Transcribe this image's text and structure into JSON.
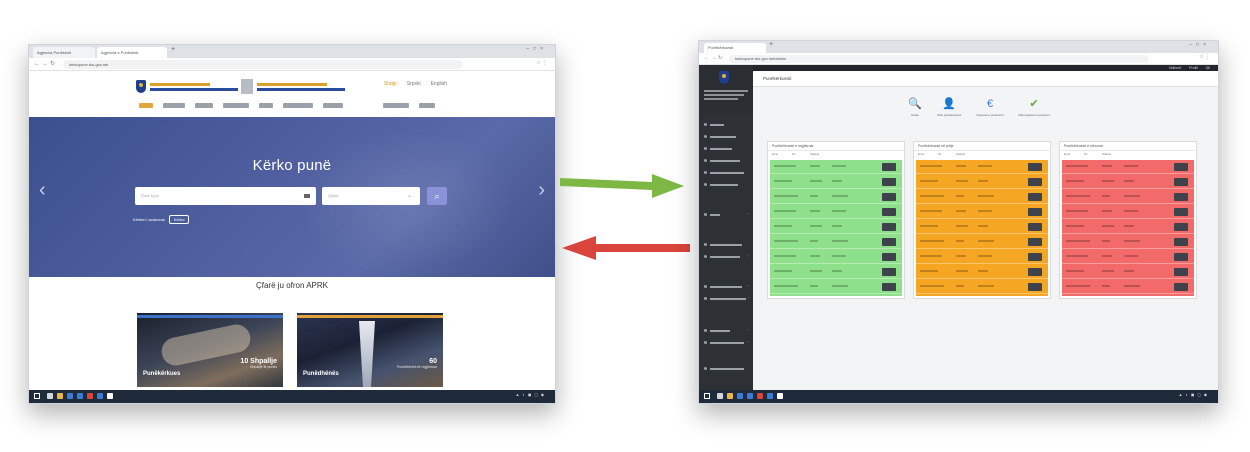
{
  "left_window": {
    "browser": {
      "tab1": "Agjencia Punësimit",
      "tab2": "Agjencia e Punësimit",
      "url": "kerkopune.rks-gov.net"
    },
    "languages": [
      "Shqip",
      "Srpski",
      "English"
    ],
    "hero": {
      "title": "Kërko punë",
      "keyword_placeholder": "Fjalë kyçe",
      "location_placeholder": "Qyteti",
      "advanced_label": "Kërkim i avancuar",
      "advanced_button": "Kërko"
    },
    "section_title": "Çfarë ju ofron APRK",
    "cards": [
      {
        "title": "Punëkërkues",
        "stat": "10 Shpallje",
        "stat_caption": "Shpallje të punës"
      },
      {
        "title": "Punëdhënës",
        "stat": "60",
        "stat_caption": "Punëdhënës të regjistruar"
      }
    ]
  },
  "right_window": {
    "browser": {
      "tab": "Punëkërkuesit",
      "url": "kerkopune.rks-gov.net/admin"
    },
    "topbar_links": [
      "Ndihmë",
      "Profili",
      "Dil"
    ],
    "page_title": "Punëkërkuesit",
    "actions": [
      {
        "icon": "🔍",
        "label": "Kërko"
      },
      {
        "icon": "👤",
        "label": "Shto punëkërkues"
      },
      {
        "icon": "€",
        "label": "Pagesat e punësimit"
      },
      {
        "icon": "✔",
        "label": "Ndërmjetësim punësimi"
      }
    ],
    "panels": [
      {
        "title": "Punëkërkuesit e regjistruar",
        "columns": [
          "Emri",
          "Nr.",
          "Statusi"
        ],
        "color": "#8fe08a",
        "rows": 9
      },
      {
        "title": "Punëkërkuesit në pritje",
        "columns": [
          "Emri",
          "Nr.",
          "Statusi"
        ],
        "color": "#f5a623",
        "rows": 9
      },
      {
        "title": "Punëkërkuesit e refuzuar",
        "columns": [
          "Emri",
          "Nr.",
          "Statusi"
        ],
        "color": "#f26a6a",
        "rows": 9
      }
    ]
  },
  "colors": {
    "arrow_forward": "#7db845",
    "arrow_back": "#d9453c",
    "accent_gold": "#e3a53c",
    "admin_sidebar": "#2d3035"
  }
}
